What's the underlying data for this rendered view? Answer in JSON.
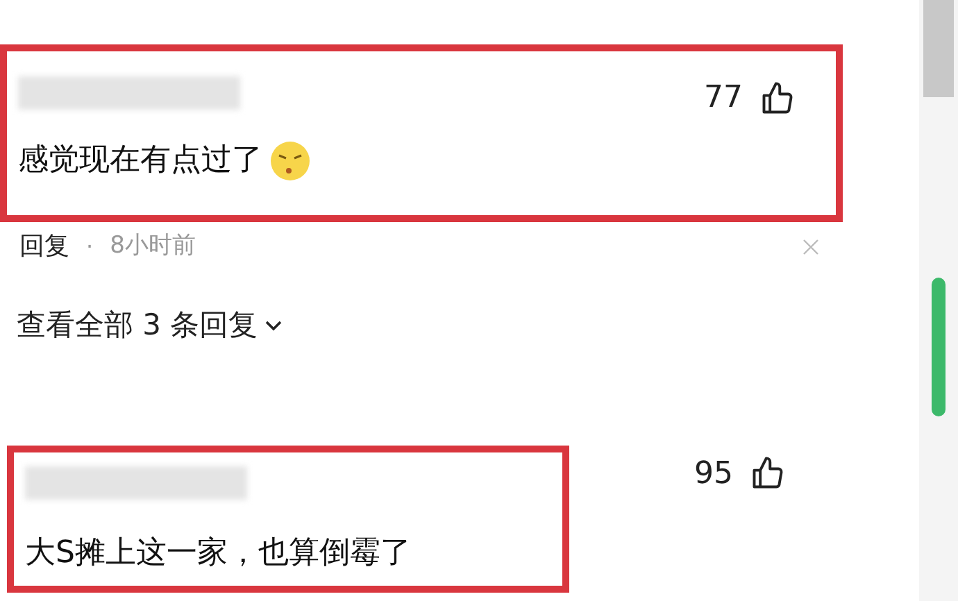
{
  "comments": [
    {
      "highlighted": true,
      "text": "感觉现在有点过了",
      "emoji": true,
      "likes": "77",
      "reply": {
        "label": "回复",
        "separator": "·",
        "time": "8小时前"
      },
      "view_replies": "查看全部 3 条回复"
    },
    {
      "highlighted": true,
      "text": "大S摊上这一家，也算倒霉了",
      "likes": "95"
    }
  ]
}
